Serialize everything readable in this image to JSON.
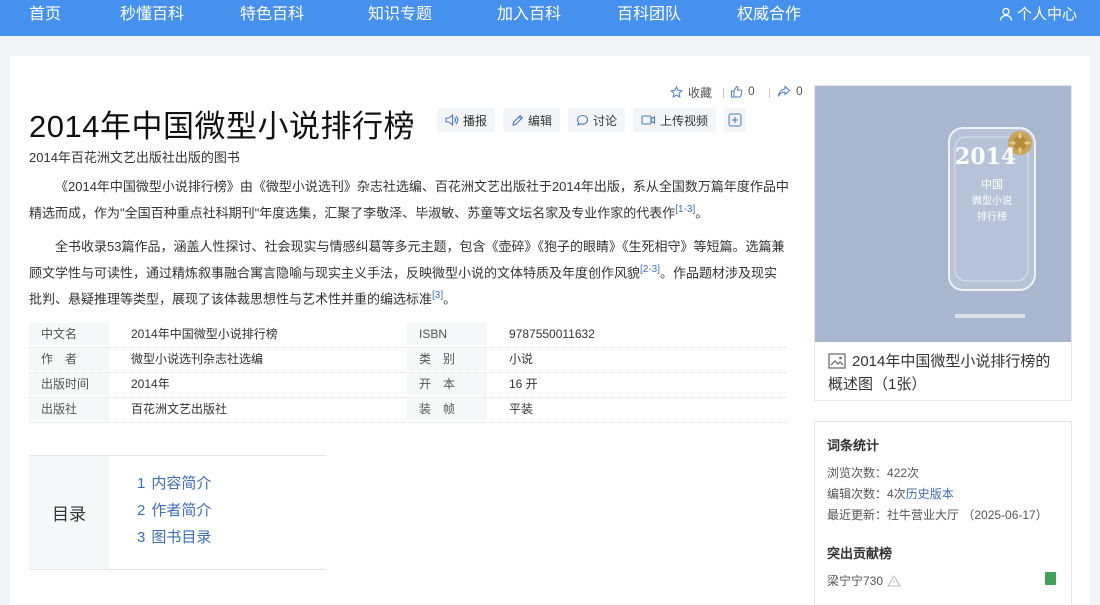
{
  "nav": {
    "items": [
      "首页",
      "秒懂百科",
      "特色百科",
      "知识专题",
      "加入百科",
      "百科团队",
      "权威合作"
    ],
    "user_center": "个人中心"
  },
  "actions": {
    "collect_label": "收藏",
    "like_count": "0",
    "share_count": "0"
  },
  "title": "2014年中国微型小说排行榜",
  "toolbar": {
    "broadcast": "播报",
    "edit": "编辑",
    "discuss": "讨论",
    "upload_video": "上传视频"
  },
  "subtitle": "2014年百花洲文艺出版社出版的图书",
  "paragraphs": {
    "p1_text": "《2014年中国微型小说排行榜》由《微型小说选刊》杂志社选编、百花洲文艺出版社于2014年出版，系从全国数万篇年度作品中精选而成，作为\"全国百种重点社科期刊\"年度选集，汇聚了李敬泽、毕淑敏、苏童等文坛名家及专业作家的代表作",
    "p1_ref": "[1-3]",
    "p1_end": "。",
    "p2_text_a": "全书收录53篇作品，涵盖人性探讨、社会现实与情感纠葛等多元主题，包含《壶碎》《狍子的眼睛》《生死相守》等短篇。选篇兼顾文学性与可读性，通过精炼叙事融合寓言隐喻与现实主义手法，反映微型小说的文体特质及年度创作风貌",
    "p2_ref_a": "[2-3]",
    "p2_text_b": "。作品题材涉及现实批判、悬疑推理等类型，展现了该体裁思想性与艺术性并重的编选标准",
    "p2_ref_b": "[3]",
    "p2_end": "。"
  },
  "info": {
    "rows": [
      {
        "k1": "中文名",
        "v1": "2014年中国微型小说排行榜",
        "k2": "ISBN",
        "v2": "9787550011632"
      },
      {
        "k1": "作　者",
        "v1": "微型小说选刊杂志社选编",
        "k2": "类　别",
        "v2": "小说"
      },
      {
        "k1": "出版时间",
        "v1": "2014年",
        "k2": "开　本",
        "v2": "16 开"
      },
      {
        "k1": "出版社",
        "v1": "百花洲文艺出版社",
        "k2": "装　帧",
        "v2": "平装"
      }
    ]
  },
  "toc": {
    "title": "目录",
    "items": [
      {
        "num": "1",
        "label": "内容简介"
      },
      {
        "num": "2",
        "label": "作者简介"
      },
      {
        "num": "3",
        "label": "图书目录"
      }
    ]
  },
  "cover": {
    "year": "2014",
    "line1": "中国",
    "line2": "微型小说",
    "line3": "排行榜",
    "caption": "2014年中国微型小说排行榜的概述图（1张）"
  },
  "stats": {
    "title": "词条统计",
    "views_label": "浏览次数：",
    "views_value": "422次",
    "edits_label": "编辑次数：",
    "edits_value": "4次",
    "history_link": "历史版本",
    "updated_label": "最近更新：",
    "updated_value": "社牛营业大厅 （2025-06-17）",
    "contrib_title": "突出贡献榜",
    "contributor": "梁宁宁730"
  },
  "colors": {
    "nav_bg": "#4791ee",
    "link": "#3b6fb6",
    "cover_bg": "#a9b7d0",
    "bookmark": "#43a05a"
  }
}
